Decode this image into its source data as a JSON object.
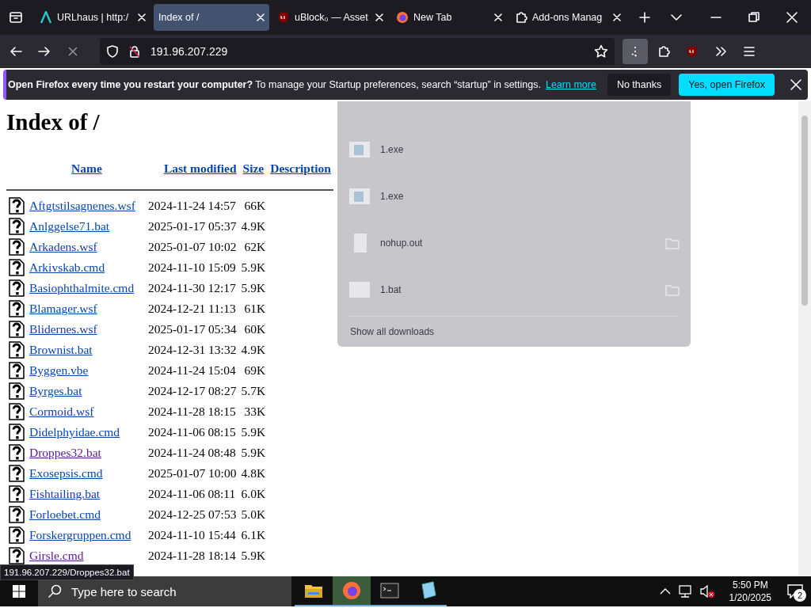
{
  "tabs": [
    {
      "title": "URLhaus | http:/",
      "selected": false
    },
    {
      "title": "Index of /",
      "selected": true
    },
    {
      "title": "uBlock₀ — Asset",
      "selected": false
    },
    {
      "title": "New Tab",
      "selected": false
    },
    {
      "title": "Add-ons Manag",
      "selected": false
    }
  ],
  "toolbar": {
    "url": "191.96.207.229",
    "loading": true,
    "downloads_open": true
  },
  "notification": {
    "message": "**Open Firefox every time you restart your computer?** To manage your Startup preferences, search “startup” in settings.",
    "link": "Learn more",
    "buttons": [
      {
        "label": "No thanks",
        "primary": false
      },
      {
        "label": "Yes, open Firefox",
        "primary": true
      }
    ]
  },
  "listing": {
    "title": "Index of /",
    "columns": [
      "Name",
      "Last modified",
      "Size",
      "Description"
    ],
    "rows": [
      {
        "name": "Aftgtstilsagnenes.wsf",
        "modified": "2024-11-24 14:57",
        "size": "66K",
        "visited": false
      },
      {
        "name": "Anlggelse71.bat",
        "modified": "2025-01-17 05:37",
        "size": "4.9K",
        "visited": false
      },
      {
        "name": "Arkadens.wsf",
        "modified": "2025-01-07 10:02",
        "size": "62K",
        "visited": false
      },
      {
        "name": "Arkivskab.cmd",
        "modified": "2024-11-10 15:09",
        "size": "5.9K",
        "visited": false
      },
      {
        "name": "Basiophthalmite.cmd",
        "modified": "2024-11-30 12:17",
        "size": "5.9K",
        "visited": false
      },
      {
        "name": "Blamager.wsf",
        "modified": "2024-12-21 11:13",
        "size": "61K",
        "visited": false
      },
      {
        "name": "Blidernes.wsf",
        "modified": "2025-01-17 05:34",
        "size": "60K",
        "visited": false
      },
      {
        "name": "Brownist.bat",
        "modified": "2024-12-31 13:32",
        "size": "4.9K",
        "visited": false
      },
      {
        "name": "Byggen.vbe",
        "modified": "2024-11-24 15:04",
        "size": "69K",
        "visited": false
      },
      {
        "name": "Byrges.bat",
        "modified": "2024-12-17 08:27",
        "size": "5.7K",
        "visited": false
      },
      {
        "name": "Cormoid.wsf",
        "modified": "2024-11-28 18:15",
        "size": "33K",
        "visited": false
      },
      {
        "name": "Didelphyidae.cmd",
        "modified": "2024-11-06 08:15",
        "size": "5.9K",
        "visited": false
      },
      {
        "name": "Droppes32.bat",
        "modified": "2024-11-24 08:48",
        "size": "5.9K",
        "visited": true
      },
      {
        "name": "Exosepsis.cmd",
        "modified": "2025-01-07 10:00",
        "size": "4.8K",
        "visited": false
      },
      {
        "name": "Fishtailing.bat",
        "modified": "2024-11-06 08:11",
        "size": "6.0K",
        "visited": false
      },
      {
        "name": "Forloebet.cmd",
        "modified": "2024-12-25 07:53",
        "size": "5.0K",
        "visited": false
      },
      {
        "name": "Forskergruppen.cmd",
        "modified": "2024-11-10 15:44",
        "size": "6.1K",
        "visited": false
      },
      {
        "name": "Girsle.cmd",
        "modified": "2024-11-28 18:14",
        "size": "5.9K",
        "visited": true
      }
    ]
  },
  "status_link": "191.96.207.229/Droppes32.bat",
  "downloads": {
    "items": [
      {
        "name": "1.exe",
        "kind": "exe",
        "folder": false
      },
      {
        "name": "1.exe",
        "kind": "exe",
        "folder": false
      },
      {
        "name": "nohup.out",
        "kind": "file",
        "folder": true
      },
      {
        "name": "1.bat",
        "kind": "bat",
        "folder": true
      }
    ],
    "footer": "Show all downloads"
  },
  "taskbar": {
    "search_placeholder": "Type here to search",
    "apps": [
      {
        "kind": "explorer",
        "active": false
      },
      {
        "kind": "firefox",
        "active": true
      },
      {
        "kind": "terminal",
        "active": false
      },
      {
        "kind": "notepad",
        "active": false
      }
    ],
    "time": "5:50 PM",
    "date": "1/20/2025",
    "notifications": "2"
  }
}
